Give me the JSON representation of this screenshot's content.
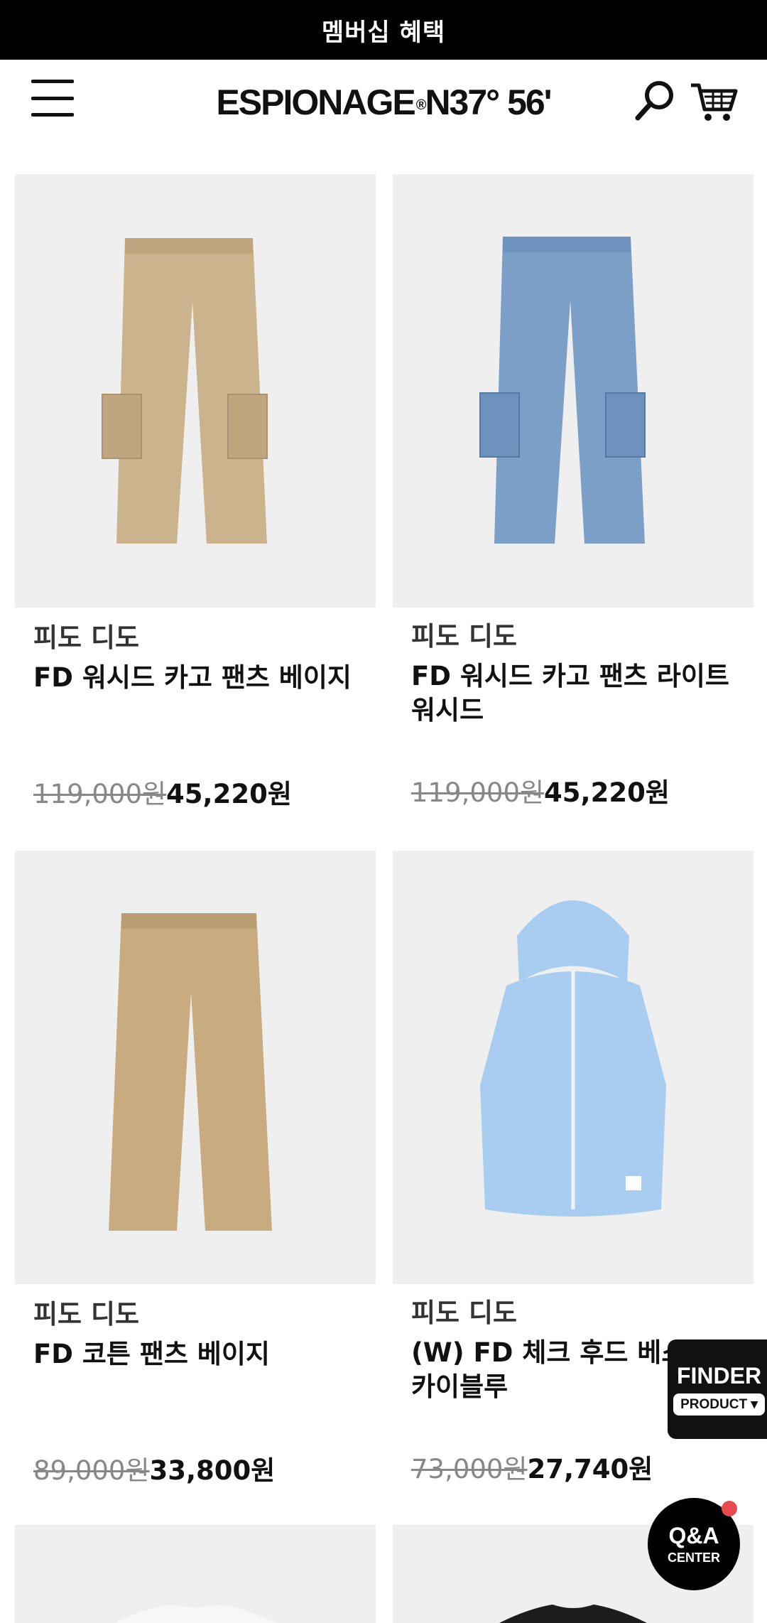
{
  "banner": {
    "text": "멤버십 혜택"
  },
  "header": {
    "logo_text": "ESPIONAGE",
    "logo_reg": "®",
    "logo_suffix": " N37° 56'",
    "icons": [
      "menu-icon",
      "search-icon",
      "cart-icon"
    ]
  },
  "products": [
    {
      "brand": "피도 디도",
      "name": "FD 워시드 카고 팬츠 베이지",
      "original_price": "119,000원",
      "sale_price": "45,220원",
      "image": "beige-cargo-pants",
      "color": "#cbb38d"
    },
    {
      "brand": "피도 디도",
      "name": "FD 워시드 카고 팬츠 라이트 워시드",
      "original_price": "119,000원",
      "sale_price": "45,220원",
      "image": "light-washed-denim-cargo-pants",
      "color": "#7b9fc7"
    },
    {
      "brand": "피도 디도",
      "name": "FD 코튼 팬츠 베이지",
      "original_price": "89,000원",
      "sale_price": "33,800원",
      "image": "beige-cotton-pants",
      "color": "#c9ab80"
    },
    {
      "brand": "피도 디도",
      "name": "(W) FD 체크 후드 베스트 스카이블루",
      "original_price": "73,000원",
      "sale_price": "27,740원",
      "image": "sky-blue-hooded-vest",
      "color": "#a9cdf0"
    }
  ],
  "finder": {
    "title": "FINDER",
    "subtitle": "PRODUCT ▾"
  },
  "qa": {
    "line1": "Q&A",
    "line2": "CENTER"
  },
  "colors": {
    "banner_bg": "#000000",
    "thumb_bg": "#efeff0",
    "badge_dot": "#e84a50"
  }
}
